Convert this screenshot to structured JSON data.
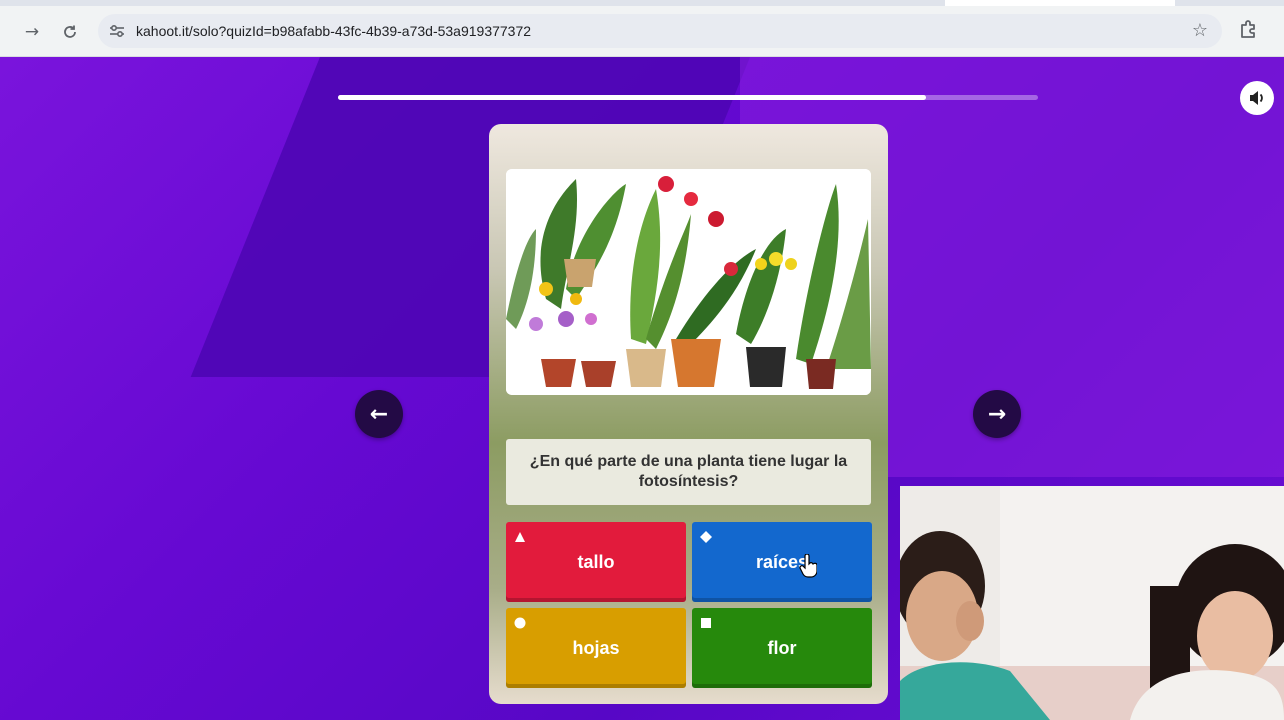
{
  "browser": {
    "url": "kahoot.it/solo?quizId=b98afabb-43fc-4b39-a73d-53a919377372",
    "icons": [
      "forward-icon",
      "reload-icon",
      "site-info-icon",
      "bookmark-star-icon",
      "extensions-icon"
    ]
  },
  "quiz": {
    "progress_fraction": 0.84,
    "question": "¿En qué parte de una planta tiene lugar la fotosíntesis?",
    "answers": [
      {
        "label": "tallo",
        "shape": "triangle",
        "color": "#e21b3c"
      },
      {
        "label": "raíces",
        "shape": "diamond",
        "color": "#1368ce"
      },
      {
        "label": "hojas",
        "shape": "circle",
        "color": "#d89e00"
      },
      {
        "label": "flor",
        "shape": "square",
        "color": "#26890c"
      }
    ],
    "icons": [
      "sound-icon",
      "arrow-left-icon",
      "arrow-right-icon"
    ]
  },
  "colors": {
    "background": "#6a0fd6",
    "nav_button": "#230a45"
  }
}
